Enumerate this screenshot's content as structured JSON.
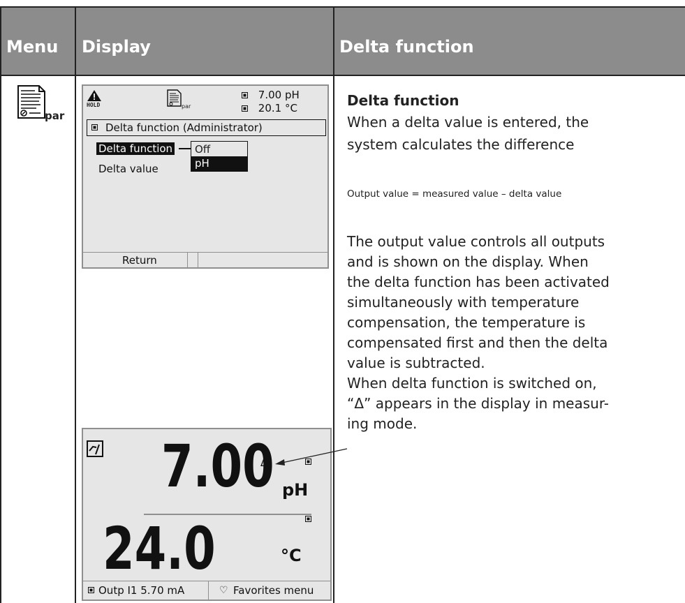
{
  "table": {
    "col_menu": "Menu",
    "col_display": "Display",
    "col_title": "Delta function"
  },
  "icons": {
    "menu_icon": "parameter-document-icon",
    "menu_icon_label": "par",
    "hold_icon": "warning-hold-icon",
    "hold_label": "HOLD",
    "param_icon": "parameter-document-icon",
    "param_icon_label": "par",
    "sensor_icon": "measuring-mode-icon",
    "favorites_icon": "heart-icon"
  },
  "screen1": {
    "ph_reading": "7.00 pH",
    "temp_reading": "20.1 °C",
    "title": "Delta function (Administrator)",
    "item_delta_function": "Delta function",
    "item_delta_value": "Delta value",
    "options": [
      "Off",
      "pH"
    ],
    "selected_option": "pH",
    "softkey_left": "Return",
    "softkey_right": ""
  },
  "screen2": {
    "main_value": "7.00",
    "main_unit": "pH",
    "delta_marker": "Δ",
    "secondary_value": "24.0",
    "secondary_unit": "°C",
    "softkey_left": "Outp I1 5.70 mA",
    "softkey_right": "Favorites menu"
  },
  "content": {
    "heading": "Delta function",
    "intro_line1": "When a delta value is entered, the",
    "intro_line2": "system calculates the difference",
    "formula": "Output value = measured value – delta value",
    "para_lines": [
      "The output value controls all outputs",
      "and is shown on the display. When",
      "the delta function has been activated",
      "simultaneously with temperature",
      "compensation, the temperature is",
      "compensated first and then the delta",
      "value is subtracted.",
      "When delta function is switched on,",
      "“Δ” appears in the display in measur-",
      "ing mode."
    ]
  }
}
